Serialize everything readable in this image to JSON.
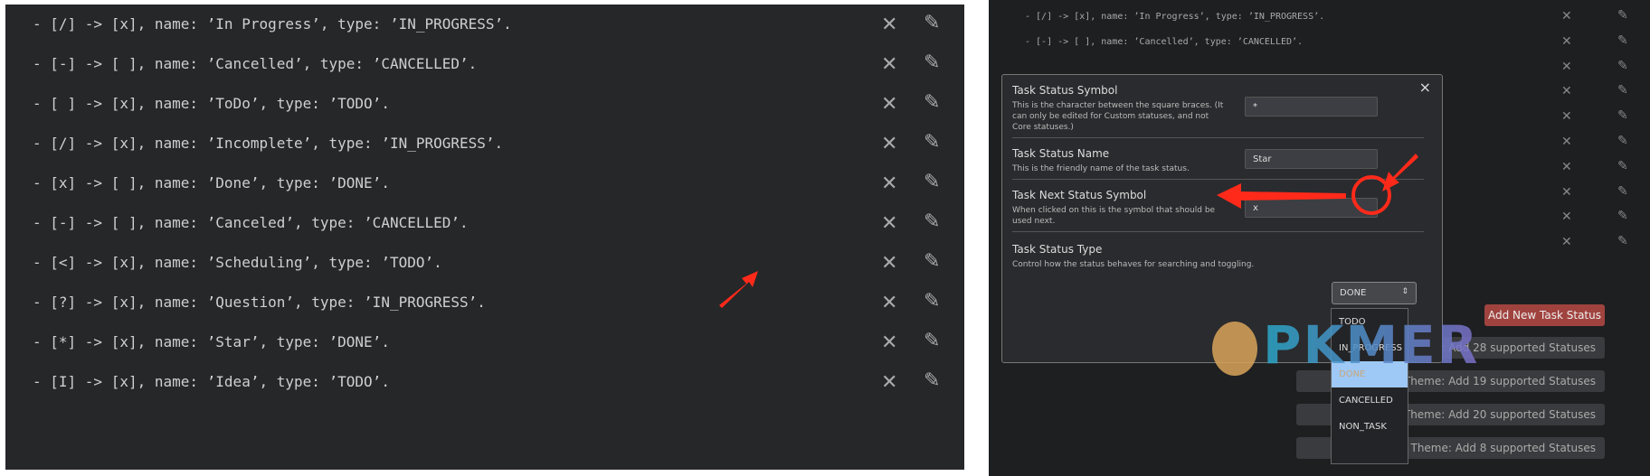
{
  "left_rows": [
    "- [/] -> [x], name: ’In Progress’, type: ’IN_PROGRESS’.",
    "- [-] -> [ ], name: ’Cancelled’, type: ’CANCELLED’.",
    "- [ ] -> [x], name: ’ToDo’, type: ’TODO’.",
    "- [/] -> [x], name: ’Incomplete’, type: ’IN_PROGRESS’.",
    "- [x] -> [ ], name: ’Done’, type: ’DONE’.",
    "- [-] -> [ ], name: ’Canceled’, type: ’CANCELLED’.",
    "- [<] -> [x], name: ’Scheduling’, type: ’TODO’.",
    "- [?] -> [x], name: ’Question’, type: ’IN_PROGRESS’.",
    "- [*] -> [x], name: ’Star’, type: ’DONE’.",
    "- [I] -> [x], name: ’Idea’, type: ’TODO’."
  ],
  "right_rows": [
    "- [/] -> [x], name: ’In Progress’, type: ’IN_PROGRESS’.",
    "- [-] -> [ ], name: ’Cancelled’, type: ’CANCELLED’.",
    "",
    "",
    "",
    "",
    "",
    "",
    "",
    ""
  ],
  "icons": {
    "delete": "close-icon",
    "edit": "pencil-icon"
  },
  "add_button": "Add New Task Status",
  "theme_buttons": [
    "Theme: Add 28 supported Statuses",
    "Theme: Add 19 supported Statuses",
    "Theme: Add 20 supported Statuses",
    "Theme: Add 8 supported Statuses"
  ],
  "modal": {
    "close": "×",
    "symbol": {
      "label": "Task Status Symbol",
      "desc": "This is the character between the square braces. (It can only be edited for Custom statuses, and not Core statuses.)",
      "value": "*"
    },
    "name": {
      "label": "Task Status Name",
      "desc": "This is the friendly name of the task status.",
      "value": "Star"
    },
    "next": {
      "label": "Task Next Status Symbol",
      "desc": "When clicked on this is the symbol that should be used next.",
      "value": "x"
    },
    "type": {
      "label": "Task Status Type",
      "desc": "Control how the status behaves for searching and toggling.",
      "value": "DONE",
      "options": [
        "TODO",
        "IN_PROGRESS",
        "DONE",
        "CANCELLED",
        "NON_TASK"
      ]
    }
  },
  "watermark": "PKMER",
  "colors": {
    "accent_red": "#a0433f",
    "annotation": "#ff2a1a"
  }
}
